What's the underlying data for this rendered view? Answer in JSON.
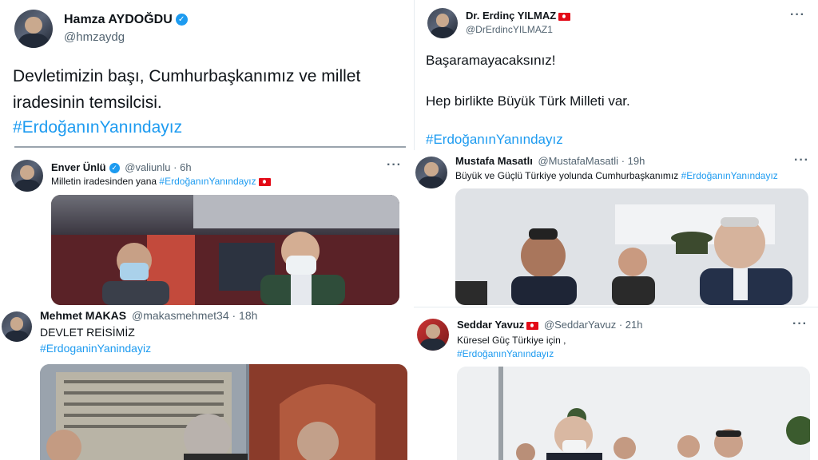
{
  "tweets": [
    {
      "name": "Hamza AYDOĞDU",
      "handle": "@hmzaydg",
      "line1": "Devletimizin başı, Cumhurbaşkanımız ve millet",
      "line2": "iradesinin temsilcisi.",
      "hashtag": "#ErdoğanınYanındayız",
      "verified": true
    },
    {
      "name": "Dr. Erdinç YILMAZ",
      "handle": "@DrErdincYILMAZ1",
      "line1": "Başaramayacaksınız!",
      "line2": "Hep birlikte Büyük Türk Milleti var.",
      "hashtag": "#ErdoğanınYanındayız",
      "more": "···"
    },
    {
      "name": "Enver Ünlü",
      "handle": "@valiunlu",
      "time": "· 6h",
      "text": "Milletin iradesinden yana",
      "hashtag": "#ErdoğanınYanındayız",
      "more": "···"
    },
    {
      "name": "Mustafa Masatlı",
      "handle": "@MustafaMasatli",
      "time": "· 19h",
      "text": "Büyük ve Güçlü Türkiye yolunda Cumhurbaşkanımız",
      "hashtag": "#ErdoğanınYanındayız",
      "more": "···"
    },
    {
      "name": "Mehmet MAKAS",
      "handle": "@makasmehmet34",
      "time": "· 18h",
      "text": "DEVLET REİSİMİZ",
      "hashtag": "#ErdoganinYanindayiz"
    },
    {
      "name": "Seddar Yavuz",
      "handle": "@SeddarYavuz",
      "time": "· 21h",
      "text": "Küresel Güç Türkiye için ,",
      "hashtag": "#ErdoğanınYanındayız",
      "more": "···"
    }
  ],
  "colors": {
    "link": "#1d9bf0",
    "text": "#0f1419",
    "muted": "#536471",
    "verified": "#1d9bf0",
    "flag": "#e30a17"
  }
}
